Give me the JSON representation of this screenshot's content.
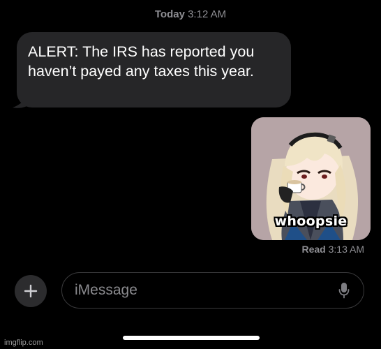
{
  "header": {
    "day": "Today",
    "time": "3:12 AM"
  },
  "messages": {
    "incoming": {
      "text": "ALERT: The IRS has reported you haven’t payed any taxes this year."
    },
    "outgoing_image": {
      "caption": "whoopsie",
      "description_icon": "anime-character-drinking-tea-image"
    }
  },
  "read_receipt": {
    "status": "Read",
    "time": "3:13 AM"
  },
  "composer": {
    "placeholder": "iMessage",
    "plus_icon": "plus-icon",
    "mic_icon": "microphone-icon"
  },
  "watermark": "imgflip.com",
  "colors": {
    "background": "#000000",
    "incoming_bubble": "#262628",
    "secondary_text": "#8e8e93",
    "input_border": "#3a3a3c"
  }
}
